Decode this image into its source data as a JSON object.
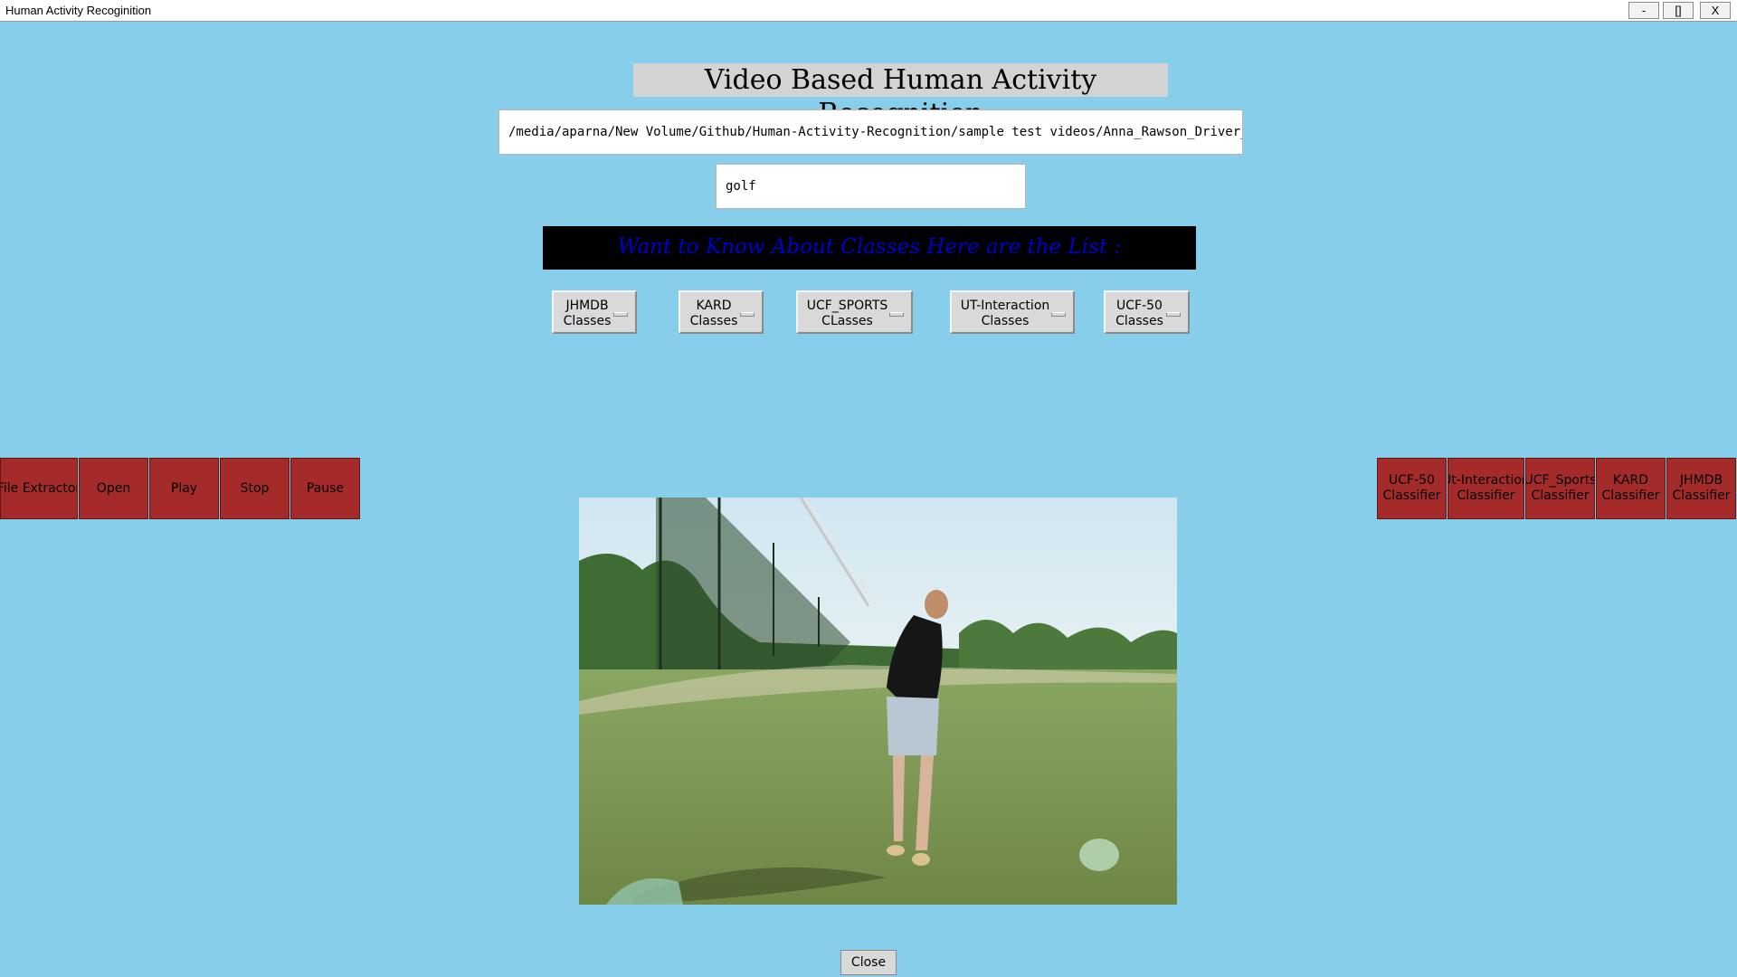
{
  "window": {
    "title": "Human Activity Recoginition",
    "minimize_label": "-",
    "maximize_label": "[]",
    "close_label": "X"
  },
  "heading": "Video Based Human Activity Recognition",
  "path_entry": {
    "value": "/media/aparna/New Volume/Github/Human-Activity-Recognition/sample test videos/Anna_Rawson_Driver_Pra"
  },
  "result_entry": {
    "value": "golf"
  },
  "banner": "Want to Know About Classes Here are the List :",
  "class_menus": [
    {
      "line1": "JHMDB",
      "line2": "Classes"
    },
    {
      "line1": "KARD",
      "line2": "Classes"
    },
    {
      "line1": "UCF_SPORTS",
      "line2": "CLasses"
    },
    {
      "line1": "UT-Interaction",
      "line2": "Classes"
    },
    {
      "line1": "UCF-50",
      "line2": "Classes"
    }
  ],
  "player_controls": [
    "File Extractor",
    "Open",
    "Play",
    "Stop",
    "Pause"
  ],
  "classifiers": [
    {
      "line1": "UCF-50",
      "line2": "Classifier"
    },
    {
      "line1": "Ut-Interaction",
      "line2": "Classifier"
    },
    {
      "line1": "UCF_Sports",
      "line2": "Classifier"
    },
    {
      "line1": "KARD",
      "line2": "Classifier"
    },
    {
      "line1": "JHMDB",
      "line2": "Classifier"
    }
  ],
  "close_button": "Close",
  "colors": {
    "background": "#87ceeb",
    "action_button": "#a52a2a",
    "banner_bg": "#000000",
    "banner_text": "#0000cd"
  },
  "video": {
    "icons": [
      "golfer-video-frame"
    ]
  }
}
